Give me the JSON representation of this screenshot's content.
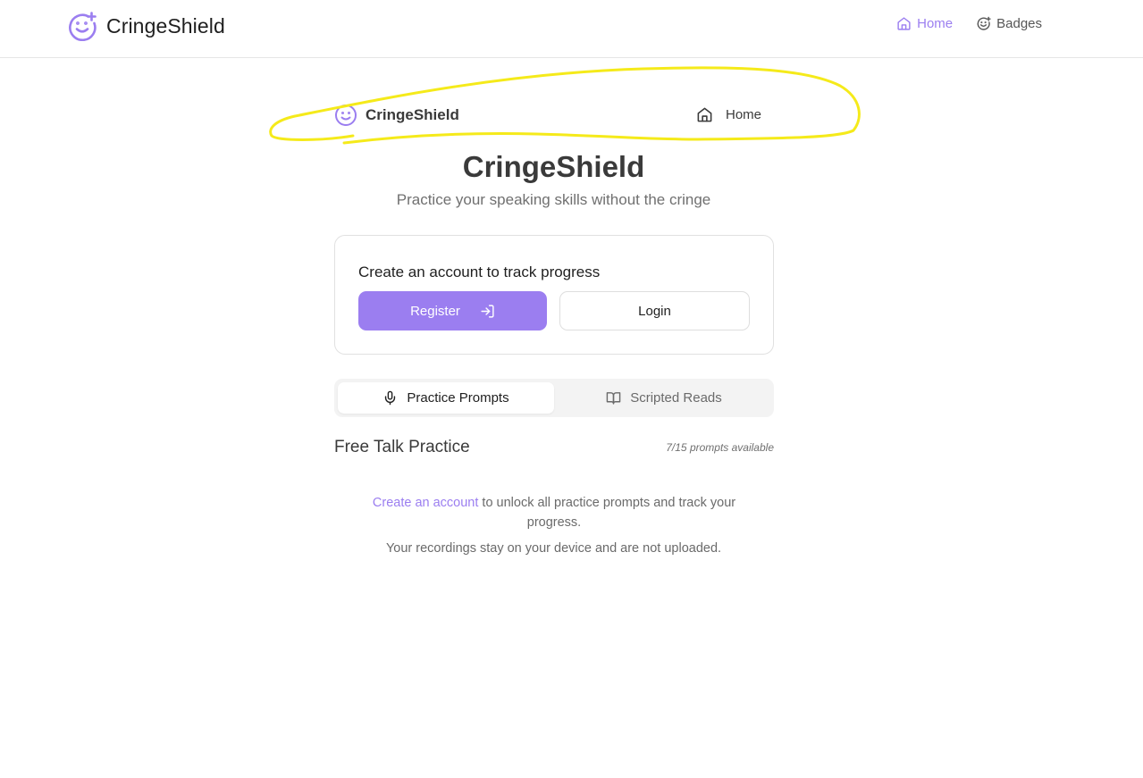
{
  "topbar": {
    "brand_name": "CringeShield",
    "nav": [
      {
        "label": "Home",
        "icon": "home-icon",
        "active": true
      },
      {
        "label": "Badges",
        "icon": "smile-plus-icon",
        "active": false
      }
    ]
  },
  "inner_header": {
    "brand_name": "CringeShield",
    "home_label": "Home"
  },
  "hero": {
    "title": "CringeShield",
    "subtitle": "Practice your speaking skills without the cringe"
  },
  "account_card": {
    "title": "Create an account to track progress",
    "register_label": "Register",
    "login_label": "Login"
  },
  "tabs": [
    {
      "label": "Practice Prompts",
      "icon": "mic-icon",
      "active": true
    },
    {
      "label": "Scripted Reads",
      "icon": "book-open-icon",
      "active": false
    }
  ],
  "section": {
    "title": "Free Talk Practice",
    "prompts_count": "7/15 prompts available"
  },
  "unlock": {
    "link_text": "Create an account",
    "rest_text": " to unlock all practice prompts and track your progress."
  },
  "privacy_text": "Your recordings stay on your device and are not uploaded.",
  "colors": {
    "accent": "#9b7ef0",
    "highlight": "#f5ea1a"
  }
}
